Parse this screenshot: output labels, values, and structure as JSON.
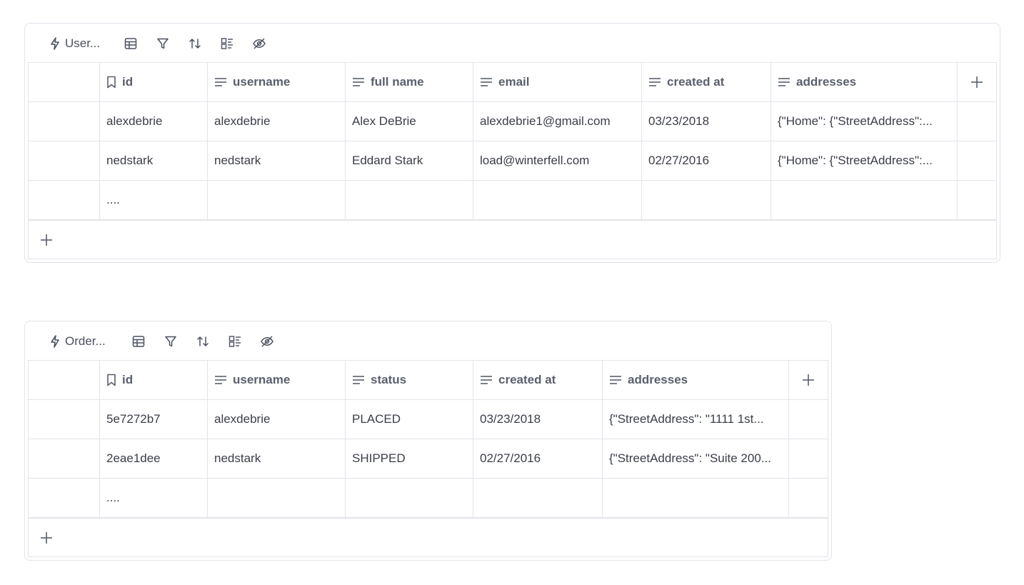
{
  "tables": [
    {
      "title": "User...",
      "toolbar_icons": [
        "table-icon",
        "filter-icon",
        "sort-icon",
        "group-icon",
        "hide-icon"
      ],
      "columns": [
        {
          "label": "id",
          "icon": "bookmark-icon"
        },
        {
          "label": "username",
          "icon": "lines-icon"
        },
        {
          "label": "full name",
          "icon": "lines-icon"
        },
        {
          "label": "email",
          "icon": "lines-icon"
        },
        {
          "label": "created at",
          "icon": "lines-icon"
        },
        {
          "label": "addresses",
          "icon": "lines-icon"
        }
      ],
      "rows": [
        [
          "alexdebrie",
          "alexdebrie",
          "Alex DeBrie",
          "alexdebrie1@gmail.com",
          "03/23/2018",
          "{\"Home\": {\"StreetAddress\":..."
        ],
        [
          "nedstark",
          "nedstark",
          "Eddard Stark",
          "load@winterfell.com",
          "02/27/2016",
          "{\"Home\": {\"StreetAddress\":..."
        ],
        [
          "....",
          "",
          "",
          "",
          "",
          ""
        ]
      ]
    },
    {
      "title": "Order...",
      "toolbar_icons": [
        "table-icon",
        "filter-icon",
        "sort-icon",
        "group-icon",
        "hide-icon"
      ],
      "columns": [
        {
          "label": "id",
          "icon": "bookmark-icon"
        },
        {
          "label": "username",
          "icon": "lines-icon"
        },
        {
          "label": "status",
          "icon": "lines-icon"
        },
        {
          "label": "created at",
          "icon": "lines-icon"
        },
        {
          "label": "addresses",
          "icon": "lines-icon"
        }
      ],
      "rows": [
        [
          "5e7272b7",
          "alexdebrie",
          "PLACED",
          "03/23/2018",
          "{\"StreetAddress\": \"1111 1st..."
        ],
        [
          "2eae1dee",
          "nedstark",
          "SHIPPED",
          "02/27/2016",
          "{\"StreetAddress\": \"Suite 200..."
        ],
        [
          "....",
          "",
          "",
          "",
          ""
        ]
      ]
    }
  ]
}
